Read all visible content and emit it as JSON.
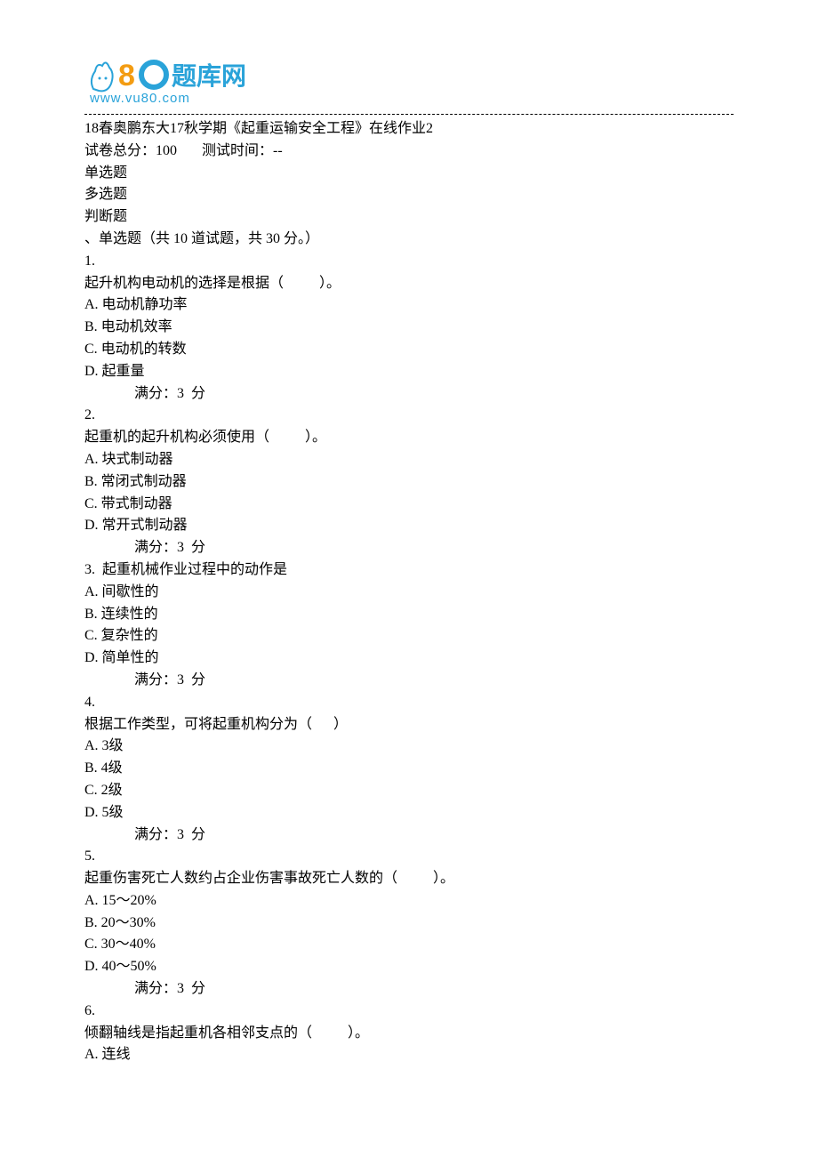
{
  "logo": {
    "text_main": "题库网",
    "url_text": "www.vu80.com"
  },
  "header": {
    "title": "18春奥鹏东大17秋学期《起重运输安全工程》在线作业2",
    "total_score_label": "试卷总分：",
    "total_score_value": "100",
    "test_time_label": "测试时间：",
    "test_time_value": "--"
  },
  "sections_list": {
    "s1": "单选题",
    "s2": "多选题",
    "s3": "判断题"
  },
  "section_single": {
    "heading": "、单选题（共 10 道试题，共 30 分。）"
  },
  "q1": {
    "num": "1.",
    "stem": "起升机构电动机的选择是根据（          ）。",
    "a": "A. 电动机静功率",
    "b": "B. 电动机效率",
    "c": "C. 电动机的转数",
    "d": "D. 起重量",
    "score": "满分：3  分"
  },
  "q2": {
    "num": "2.",
    "stem": "起重机的起升机构必须使用（          ）。",
    "a": "A. 块式制动器",
    "b": "B. 常闭式制动器",
    "c": "C. 带式制动器",
    "d": "D. 常开式制动器",
    "score": "满分：3  分"
  },
  "q3": {
    "num_and_stem": "3.  起重机械作业过程中的动作是",
    "a": "A. 间歇性的",
    "b": "B. 连续性的",
    "c": "C. 复杂性的",
    "d": "D. 简单性的",
    "score": "满分：3  分"
  },
  "q4": {
    "num": "4.",
    "stem": "根据工作类型，可将起重机构分为（      ）",
    "a": "A. 3级",
    "b": "B. 4级",
    "c": "C. 2级",
    "d": "D. 5级",
    "score": "满分：3  分"
  },
  "q5": {
    "num": "5.",
    "stem": "起重伤害死亡人数约占企业伤害事故死亡人数的（          ）。",
    "a": "A. 15～20%",
    "b": "B. 20～30%",
    "c": "C. 30～40%",
    "d": "D. 40～50%",
    "score": "满分：3  分"
  },
  "q6": {
    "num": "6.",
    "stem": "倾翻轴线是指起重机各相邻支点的（          ）。",
    "a": "A. 连线"
  }
}
